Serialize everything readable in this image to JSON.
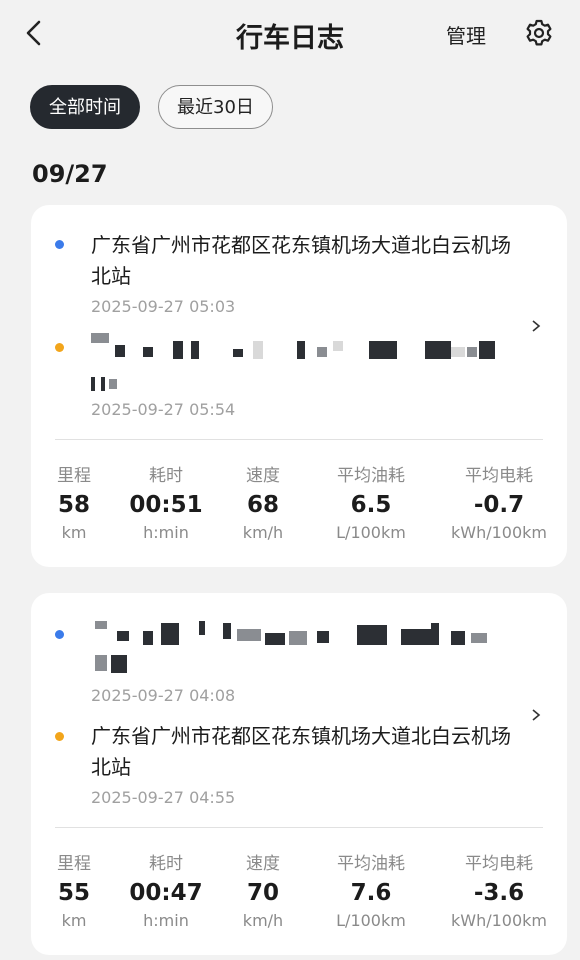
{
  "header": {
    "title": "行车日志",
    "manage_label": "管理"
  },
  "filters": [
    {
      "label": "全部时间",
      "active": true
    },
    {
      "label": "最近30日",
      "active": false
    }
  ],
  "date_heading": "09/27",
  "trips": [
    {
      "start": {
        "address": "广东省广州市花都区花东镇机场大道北白云机场北站",
        "time": "2025-09-27 05:03"
      },
      "end": {
        "address": "",
        "time": "2025-09-27 05:54"
      },
      "stats": [
        {
          "label": "里程",
          "value": "58",
          "unit": "km"
        },
        {
          "label": "耗时",
          "value": "00:51",
          "unit": "h:min"
        },
        {
          "label": "速度",
          "value": "68",
          "unit": "km/h"
        },
        {
          "label": "平均油耗",
          "value": "6.5",
          "unit": "L/100km"
        },
        {
          "label": "平均电耗",
          "value": "-0.7",
          "unit": "kWh/100km"
        }
      ]
    },
    {
      "start": {
        "address": "",
        "time": "2025-09-27 04:08"
      },
      "end": {
        "address": "广东省广州市花都区花东镇机场大道北白云机场北站",
        "time": "2025-09-27 04:55"
      },
      "stats": [
        {
          "label": "里程",
          "value": "55",
          "unit": "km"
        },
        {
          "label": "耗时",
          "value": "00:47",
          "unit": "h:min"
        },
        {
          "label": "速度",
          "value": "70",
          "unit": "km/h"
        },
        {
          "label": "平均油耗",
          "value": "7.6",
          "unit": "L/100km"
        },
        {
          "label": "平均电耗",
          "value": "-3.6",
          "unit": "kWh/100km"
        }
      ]
    }
  ]
}
